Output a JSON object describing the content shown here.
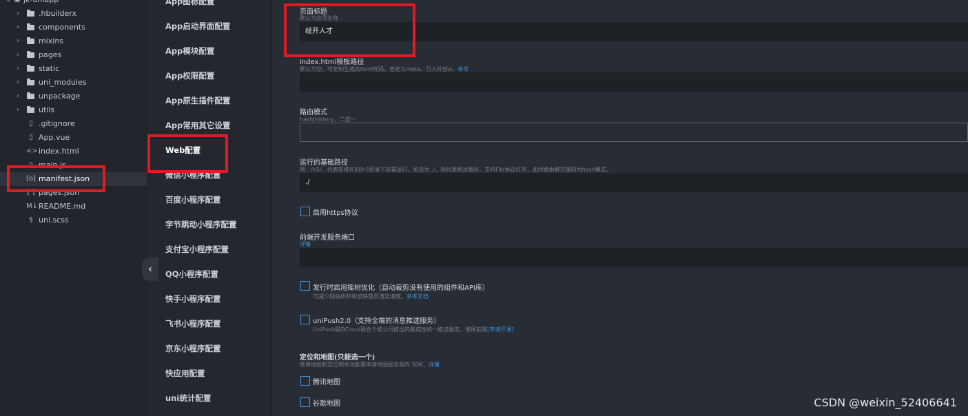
{
  "tree": {
    "root": "jk-uniapp",
    "items": [
      {
        "name": ".hbuilderx",
        "type": "folder",
        "icon": "folder-icon"
      },
      {
        "name": "components",
        "type": "folder",
        "icon": "folder-icon"
      },
      {
        "name": "mixins",
        "type": "folder",
        "icon": "folder-icon"
      },
      {
        "name": "pages",
        "type": "folder",
        "icon": "folder-icon"
      },
      {
        "name": "static",
        "type": "folder",
        "icon": "folder-icon"
      },
      {
        "name": "uni_modules",
        "type": "folder",
        "icon": "folder-icon"
      },
      {
        "name": "unpackage",
        "type": "folder",
        "icon": "folder-icon"
      },
      {
        "name": "utils",
        "type": "folder",
        "icon": "folder-icon"
      },
      {
        "name": ".gitignore",
        "type": "file",
        "icon": "file-icon",
        "glyph": "▯"
      },
      {
        "name": "App.vue",
        "type": "file",
        "icon": "vue-file-icon",
        "glyph": "▯"
      },
      {
        "name": "index.html",
        "type": "file",
        "icon": "html-file-icon",
        "glyph": "<>"
      },
      {
        "name": "main.js",
        "type": "file",
        "icon": "js-file-icon",
        "glyph": "▯"
      },
      {
        "name": "manifest.json",
        "type": "file",
        "icon": "json-file-icon",
        "glyph": "[o]",
        "selected": true
      },
      {
        "name": "pages.json",
        "type": "file",
        "icon": "json-file-icon",
        "glyph": "[ ]"
      },
      {
        "name": "README.md",
        "type": "file",
        "icon": "markdown-file-icon",
        "glyph": "M↓"
      },
      {
        "name": "uni.scss",
        "type": "file",
        "icon": "scss-file-icon",
        "glyph": "§"
      }
    ]
  },
  "menu": {
    "items": [
      {
        "label": "App图标配置"
      },
      {
        "label": "App启动界面配置"
      },
      {
        "label": "App模块配置"
      },
      {
        "label": "App权限配置"
      },
      {
        "label": "App原生插件配置"
      },
      {
        "label": "App常用其它设置"
      },
      {
        "label": "Web配置",
        "active": true
      },
      {
        "label": "微信小程序配置"
      },
      {
        "label": "百度小程序配置"
      },
      {
        "label": "字节跳动小程序配置"
      },
      {
        "label": "支付宝小程序配置"
      },
      {
        "label": "QQ小程序配置"
      },
      {
        "label": "快手小程序配置"
      },
      {
        "label": "飞书小程序配置"
      },
      {
        "label": "京东小程序配置"
      },
      {
        "label": "快应用配置"
      },
      {
        "label": "uni统计配置"
      }
    ],
    "collapse_icon": "chevron-left-icon",
    "collapse_glyph": "‹"
  },
  "form": {
    "title": {
      "label": "页面标题",
      "hint": "默认为应用名称",
      "value": "经开人才"
    },
    "template": {
      "label": "index.html模板路径",
      "hint": "默认为空，可定制生成的html代码，自定义meta、引入外部js，",
      "link": "参考",
      "value": ""
    },
    "router": {
      "label": "路由模式",
      "hint": "hash|history，二选一",
      "value": ""
    },
    "base": {
      "label": "运行的基础路径",
      "hint": "例：/h5/，代表在域名的/h5目录下部署运行。如设为 ./，则代表相对路径，支持File协议打开，此时路由模式强制为hash模式。",
      "value": "./"
    },
    "https": {
      "label": "启用https协议",
      "checked": false
    },
    "port": {
      "label": "前端开发服务端口",
      "link": "详情",
      "value": ""
    },
    "treeshake": {
      "label": "发行时启用摇树优化（自动裁剪没有使用的组件和API库）",
      "hint": "可减少网站体积和加快首页渲染速度。",
      "link": "参考文档",
      "checked": false
    },
    "unipush": {
      "label": "uniPush2.0（支持全端的消息推送服务）",
      "hint": "UniPush是DCloud联合个推公司推出的集成性统一推送服务，使用前需",
      "link": "[申请开通]",
      "checked": false
    },
    "map": {
      "label": "定位和地图(只能选一个)",
      "hint": "使用地图和定位相关功能需申请地图服务商的 SDK，",
      "link": "详情"
    },
    "tencent_map": {
      "label": "腾讯地图",
      "checked": false
    },
    "google_map": {
      "label": "谷歌地图",
      "checked": false
    }
  },
  "colors": {
    "highlight": "#e11b22",
    "link": "#3a8fd8",
    "checkbox": "#4a8fe0"
  },
  "watermark": "CSDN @weixin_52406641"
}
